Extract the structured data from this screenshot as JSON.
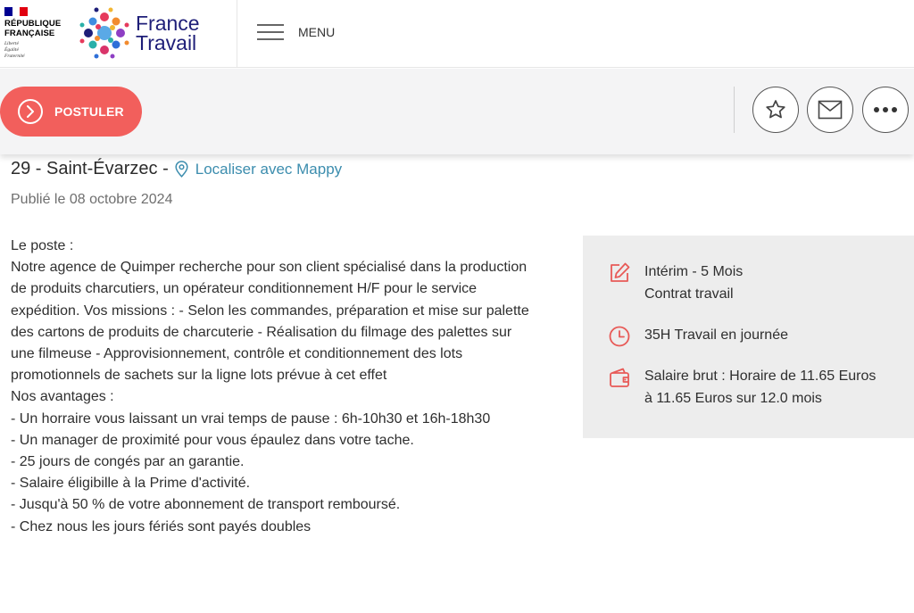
{
  "header": {
    "gov_name_line1": "RÉPUBLIQUE",
    "gov_name_line2": "FRANÇAISE",
    "gov_motto_1": "Liberté",
    "gov_motto_2": "Égalité",
    "gov_motto_3": "Fraternité",
    "brand_line1": "France",
    "brand_line2": "Travail",
    "menu_label": "MENU"
  },
  "action_bar": {
    "apply_label": "POSTULER",
    "favorite_icon": "star-icon",
    "share_icon": "envelope-icon",
    "more_icon": "more-dots-icon"
  },
  "offer": {
    "location": "29 - Saint-Évarzec -",
    "map_link": "Localiser avec Mappy",
    "published": "Publié le 08 octobre 2024",
    "description": [
      "Le poste :",
      "Notre agence de Quimper recherche pour son client spécialisé dans la production de produits charcutiers, un opérateur conditionnement H/F pour le service expédition. Vos missions : - Selon les commandes, préparation et mise sur palette des cartons de produits de charcuterie - Réalisation du filmage des palettes sur une filmeuse - Approvisionnement, contrôle et conditionnement des lots promotionnels de sachets sur la ligne lots prévue à cet effet",
      "Nos avantages :",
      "- Un horraire vous laissant un vrai temps de pause : 6h-10h30  et 16h-18h30",
      "- Un manager de proximité pour vous épaulez dans votre tache.",
      "- 25 jours de congés par an garantie.",
      "- Salaire éligibille à la Prime d'activité.",
      "- Jusqu'à 50 % de votre abonnement de transport remboursé.",
      "- Chez nous les jours fériés sont payés doubles"
    ]
  },
  "info": {
    "contract_line1": "Intérim - 5 Mois",
    "contract_line2": "Contrat travail",
    "hours": "35H Travail en journée",
    "salary": "Salaire brut : Horaire de 11.65 Euros à 11.65 Euros sur 12.0 mois"
  },
  "colors": {
    "accent": "#f25f5c",
    "link": "#3c8dae",
    "brand": "#1e1e78",
    "flag_blue": "#000091",
    "flag_red": "#e1000f"
  }
}
